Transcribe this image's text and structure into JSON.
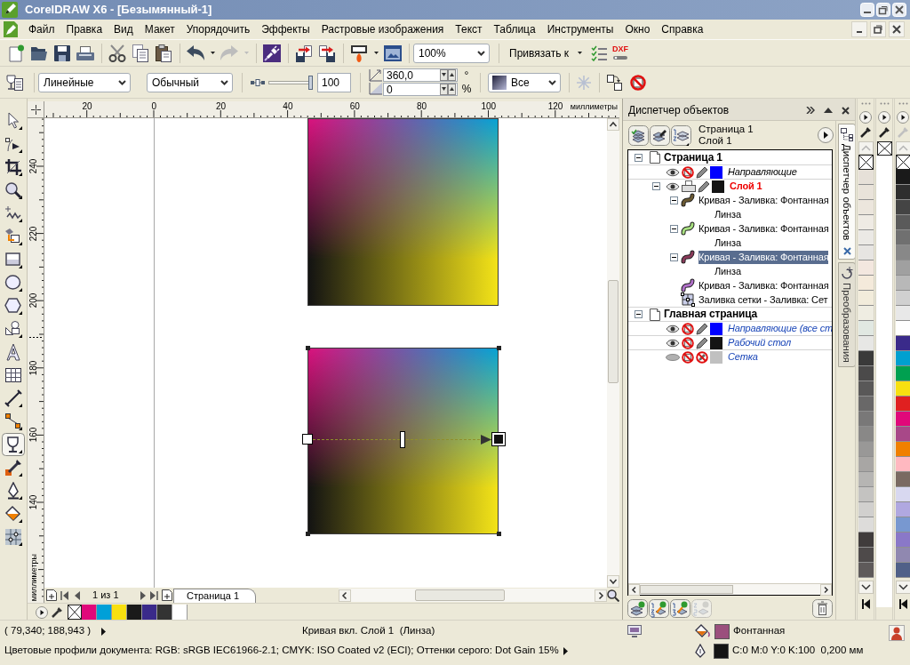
{
  "window": {
    "title": "CorelDRAW X6 - [Безымянный-1]"
  },
  "menu": [
    "Файл",
    "Правка",
    "Вид",
    "Макет",
    "Упорядочить",
    "Эффекты",
    "Растровые изображения",
    "Текст",
    "Таблица",
    "Инструменты",
    "Окно",
    "Справка"
  ],
  "standard_toolbar": {
    "redo_disabled": true,
    "zoom": "100%",
    "snap_to": "Привязать к",
    "dxf": "DXF"
  },
  "property_bar": {
    "transparency_type": "Линейные",
    "merge_mode": "Обычный",
    "transparency": {
      "level": 1,
      "reading": "100"
    },
    "angle": "360,0",
    "angle_unit": "°",
    "edge_pad": "0",
    "edge_pad_unit": "%",
    "target": "Все",
    "freeze_disabled": true
  },
  "toolbox": {
    "tools": [
      {
        "kind": "pick",
        "selected": false
      },
      {
        "kind": "shape",
        "selected": false
      },
      {
        "kind": "crop",
        "selected": false
      },
      {
        "kind": "zoom",
        "selected": false
      },
      {
        "kind": "freehand",
        "selected": false
      },
      {
        "kind": "smart_fill",
        "selected": false
      },
      {
        "kind": "rectangle",
        "selected": false
      },
      {
        "kind": "ellipse",
        "selected": false
      },
      {
        "kind": "polygon",
        "selected": false
      },
      {
        "kind": "basic_shapes",
        "selected": false
      },
      {
        "kind": "text",
        "selected": false
      },
      {
        "kind": "table",
        "selected": false
      },
      {
        "kind": "dimension",
        "selected": false
      },
      {
        "kind": "connector",
        "selected": false
      },
      {
        "kind": "transparency",
        "selected": true
      },
      {
        "kind": "color_eyedropper",
        "selected": false
      },
      {
        "kind": "outline",
        "selected": false
      },
      {
        "kind": "fill",
        "selected": false
      },
      {
        "kind": "mesh_fill",
        "selected": false
      }
    ]
  },
  "rulers": {
    "horizontal": [
      "20",
      "0",
      "20",
      "40",
      "60",
      "80",
      "100",
      "120"
    ],
    "horizontal_unit": "миллиметры",
    "vertical": [
      "240",
      "220",
      "200",
      "180",
      "160",
      "140"
    ],
    "vertical_unit": "миллиметры"
  },
  "canvas": {
    "transparency_midpoint": {
      "level": 0.5
    }
  },
  "page_navigator": {
    "counter": "1 из 1",
    "tabs": [
      {
        "label": "Страница 1",
        "selected": true
      }
    ]
  },
  "document_palette": {
    "swatches": [
      {
        "color": "#e0087a"
      },
      {
        "color": "#00a0d8"
      },
      {
        "color": "#f8e010"
      },
      {
        "color": "#1a1a1a"
      },
      {
        "color": "#3a2a8a"
      },
      {
        "color": "#333333"
      },
      {
        "color": "#ffffff"
      }
    ]
  },
  "object_manager": {
    "title": "Диспетчер объектов",
    "current_page": "Страница 1",
    "current_layer": "Слой 1",
    "tree": [
      {
        "kind": "page",
        "label": "Страница 1",
        "expanded": true,
        "selected": false,
        "children": [
          {
            "kind": "special_layer",
            "label": "Направляющие",
            "visible": true,
            "printable": false,
            "editable": true,
            "color": "#0000ff",
            "selected": false
          },
          {
            "kind": "layer",
            "label": "Слой 1",
            "active": true,
            "expanded": true,
            "visible": true,
            "printable": true,
            "editable": true,
            "color": "#141414",
            "selected": false,
            "children": [
              {
                "kind": "curve",
                "label": "Кривая - Заливка: Фонтанная",
                "color": "#6b5a32",
                "expanded": true,
                "selected": false,
                "children": [
                  {
                    "kind": "effect",
                    "label": "Линза",
                    "selected": false
                  }
                ]
              },
              {
                "kind": "curve",
                "label": "Кривая - Заливка: Фонтанная",
                "color": "#a8e080",
                "expanded": true,
                "selected": false,
                "children": [
                  {
                    "kind": "effect",
                    "label": "Линза",
                    "selected": false
                  }
                ]
              },
              {
                "kind": "curve",
                "label": "Кривая - Заливка: Фонтанная",
                "color": "#8a3a5a",
                "expanded": true,
                "selected": true,
                "children": [
                  {
                    "kind": "effect",
                    "label": "Линза",
                    "selected": false
                  }
                ]
              },
              {
                "kind": "curve",
                "label": "Кривая - Заливка: Фонтанная",
                "color": "#b070c8",
                "selected": false
              },
              {
                "kind": "mesh",
                "label": "Заливка сетки - Заливка: Сет",
                "selected": false
              }
            ]
          }
        ]
      },
      {
        "kind": "page",
        "label": "Главная страница",
        "expanded": true,
        "selected": false,
        "children": [
          {
            "kind": "master_layer",
            "label": "Направляющие (все ст",
            "visible": true,
            "printable": false,
            "editable": true,
            "color": "#0000ff",
            "selected": false
          },
          {
            "kind": "master_layer",
            "label": "Рабочий стол",
            "visible": true,
            "printable": false,
            "editable": true,
            "color": "#141414",
            "selected": false
          },
          {
            "kind": "master_layer",
            "label": "Сетка",
            "visible": false,
            "printable": false,
            "editable": false,
            "color": "#c0c0c0",
            "selected": false
          }
        ]
      }
    ],
    "new_layer_buttons": [
      {
        "kind": "layer",
        "disabled": false
      },
      {
        "kind": "master",
        "disabled": false
      },
      {
        "kind": "master_odd",
        "disabled": false
      },
      {
        "kind": "master_even",
        "disabled": true
      }
    ]
  },
  "docker_tabs": [
    {
      "kind": "objects",
      "label": "Диспетчер объектов",
      "selected": true
    },
    {
      "kind": "transform",
      "label": "Преобразования",
      "selected": false
    }
  ],
  "palettes": [
    {
      "eyedropper_disabled": false,
      "scrollable": true,
      "can_scroll_up": false,
      "swatches": [
        {
          "color": "#e6e0d8"
        },
        {
          "color": "#e9e3da"
        },
        {
          "color": "#ece6dd"
        },
        {
          "color": "#efebe4"
        },
        {
          "color": "#ebe9e5"
        },
        {
          "color": "#e7e5e2"
        },
        {
          "color": "#f3e7df"
        },
        {
          "color": "#f4eadb"
        },
        {
          "color": "#f2ecdb"
        },
        {
          "color": "#efede2"
        },
        {
          "color": "#e1e8e2"
        },
        {
          "color": "#e7e7e5"
        },
        {
          "color": "#3a3a3a"
        },
        {
          "color": "#4b4a4a"
        },
        {
          "color": "#595858"
        },
        {
          "color": "#696868"
        },
        {
          "color": "#797878"
        },
        {
          "color": "#898887"
        },
        {
          "color": "#999897"
        },
        {
          "color": "#a8a6a4"
        },
        {
          "color": "#b6b5b3"
        },
        {
          "color": "#c4c3c1"
        },
        {
          "color": "#d1d0ce"
        },
        {
          "color": "#dddcda"
        },
        {
          "color": "#403c3c"
        },
        {
          "color": "#4e4a4a"
        },
        {
          "color": "#5e5a5a"
        }
      ]
    },
    {
      "eyedropper_disabled": false,
      "scrollable": false
    },
    {
      "eyedropper_disabled": true,
      "scrollable": true,
      "can_scroll_up": false,
      "swatches": [
        {
          "color": "#1a1a1a"
        },
        {
          "color": "#2e2e2e"
        },
        {
          "color": "#444444"
        },
        {
          "color": "#5a5a5a"
        },
        {
          "color": "#707070"
        },
        {
          "color": "#888888"
        },
        {
          "color": "#a0a0a0"
        },
        {
          "color": "#b8b8b8"
        },
        {
          "color": "#d0d0d0"
        },
        {
          "color": "#e8e8e8"
        },
        {
          "color": "#ffffff"
        },
        {
          "color": "#3a2a8a"
        },
        {
          "color": "#00a0d0"
        },
        {
          "color": "#00a050"
        },
        {
          "color": "#f8e010"
        },
        {
          "color": "#e02020"
        },
        {
          "color": "#e0087a"
        },
        {
          "color": "#a84888"
        },
        {
          "color": "#f08000"
        },
        {
          "color": "#ffb8c0"
        },
        {
          "color": "#7a6a62"
        },
        {
          "color": "#d8d8f0"
        },
        {
          "color": "#b0a8e0"
        },
        {
          "color": "#7898d0"
        },
        {
          "color": "#8a78c8"
        },
        {
          "color": "#9088b0"
        },
        {
          "color": "#506088"
        }
      ]
    }
  ],
  "status_bar": {
    "coordinates": "( 79,340; 188,943 )",
    "selection_info": "Кривая вкл. Слой 1  (Линза)",
    "color_profiles": "Цветовые профили документа: RGB: sRGB IEC61966-2.1; CMYK: ISO Coated v2 (ECI); Оттенки серого: Dot Gain 15%",
    "fill": {
      "color": "#9b4f7d",
      "label": "Фонтанная"
    },
    "outline": {
      "color": "#141414",
      "label": "C:0 M:0 Y:0 K:100  0,200 мм"
    }
  }
}
